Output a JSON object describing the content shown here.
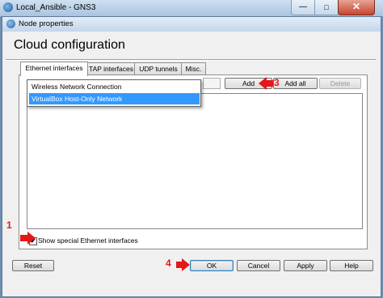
{
  "window": {
    "title": "Local_Ansible - GNS3",
    "minimize_label": "—",
    "maximize_label": "□",
    "close_label": "✕"
  },
  "dialog": {
    "title": "Node properties",
    "heading": "Cloud configuration"
  },
  "tabs": [
    {
      "label": "Ethernet interfaces",
      "selected": true
    },
    {
      "label": "TAP interfaces"
    },
    {
      "label": "UDP tunnels"
    },
    {
      "label": "Misc."
    }
  ],
  "interface_dropdown": {
    "options": [
      "Wireless Network Connection",
      "VirtualBox Host-Only Network"
    ],
    "highlighted_index": 1
  },
  "buttons": {
    "add": "Add",
    "add_all": "Add all",
    "delete": "Delete",
    "reset": "Reset",
    "ok": "OK",
    "cancel": "Cancel",
    "apply": "Apply",
    "help": "Help"
  },
  "checkbox": {
    "label": "Show special Ethernet interfaces",
    "checked": true,
    "mark": "✔"
  },
  "annotations": [
    "1",
    "2",
    "3",
    "4"
  ],
  "colors": {
    "annotation_red": "#e11919",
    "selection_blue": "#3399ff"
  }
}
